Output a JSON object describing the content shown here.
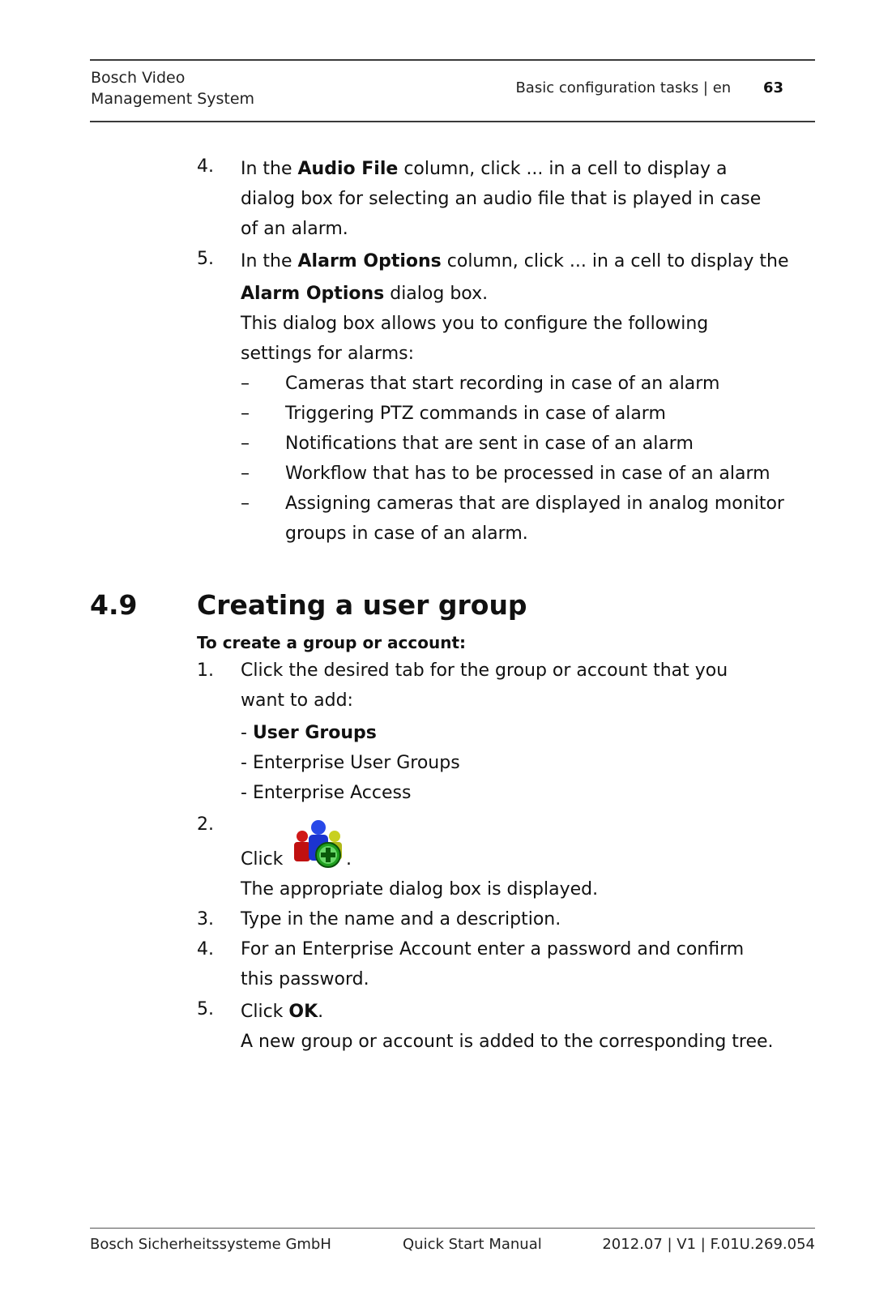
{
  "header": {
    "product_line1": "Bosch Video",
    "product_line2": "Management System",
    "section": "Basic configuration tasks | en",
    "page_number": "63"
  },
  "top_list": {
    "item4": {
      "number": "4.",
      "pre": "In the ",
      "bold": "Audio File",
      "post": " column, click ... in a cell to display a",
      "line2": "dialog box for selecting an audio file that is played in case",
      "line3": "of an alarm."
    },
    "item5": {
      "number": "5.",
      "pre": "In the ",
      "bold": "Alarm Options",
      "post": " column, click ... in a cell to display the",
      "line2_bold": "Alarm Options",
      "line2_post": " dialog box.",
      "para_line1": "This dialog box allows you to configure the following",
      "para_line2": "settings for alarms:",
      "dash": "–",
      "bullets": [
        "Cameras that start recording in case of an alarm",
        "Triggering PTZ commands in case of alarm",
        "Notifications that are sent in case of an alarm",
        "Workflow that has to be processed in case of an alarm",
        "Assigning cameras that are displayed in analog monitor"
      ],
      "bullet5_line2": "groups in case of an alarm."
    }
  },
  "section": {
    "number": "4.9",
    "title": "Creating a user group",
    "procedure_title": "To create a group or account:",
    "steps": {
      "s1": {
        "number": "1.",
        "line1": "Click the desired tab for the group or account that you",
        "line2": "want to add:",
        "options": [
          {
            "prefix": "- ",
            "label": "User Groups",
            "bold": true
          },
          {
            "prefix": "- ",
            "label": "Enterprise User Groups",
            "bold": false
          },
          {
            "prefix": "- ",
            "label": "Enterprise Access",
            "bold": false
          }
        ]
      },
      "s2": {
        "number": "2.",
        "pre": "Click ",
        "icon": "add-user-group-icon",
        "post": ".",
        "result": "The appropriate dialog box is displayed."
      },
      "s3": {
        "number": "3.",
        "text": "Type in the name and a description."
      },
      "s4": {
        "number": "4.",
        "line1": "For an Enterprise Account enter a password and confirm",
        "line2": "this password."
      },
      "s5": {
        "number": "5.",
        "pre": "Click ",
        "bold": "OK",
        "post": ".",
        "result": "A new group or account is added to the corresponding tree."
      }
    }
  },
  "footer": {
    "company": "Bosch Sicherheitssysteme GmbH",
    "doc_type": "Quick Start Manual",
    "doc_id": "2012.07 | V1 | F.01U.269.054"
  },
  "colors": {
    "text": "#111111",
    "rule": "#3a3a3a",
    "icon_red": "#d01818",
    "icon_blue": "#2040e0",
    "icon_yellow": "#c8d020",
    "icon_green": "#18a818"
  }
}
